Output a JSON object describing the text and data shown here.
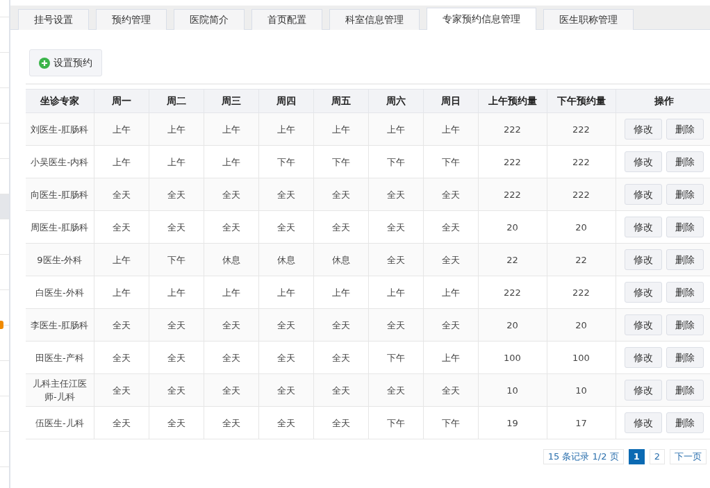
{
  "tabs": [
    {
      "label": "挂号设置",
      "selected": false
    },
    {
      "label": "预约管理",
      "selected": false
    },
    {
      "label": "医院简介",
      "selected": false
    },
    {
      "label": "首页配置",
      "selected": false
    },
    {
      "label": "科室信息管理",
      "selected": false
    },
    {
      "label": "专家预约信息管理",
      "selected": true
    },
    {
      "label": "医生职称管理",
      "selected": false
    }
  ],
  "toolbar": {
    "add_button": "设置预约"
  },
  "table": {
    "columns": [
      "坐诊专家",
      "周一",
      "周二",
      "周三",
      "周四",
      "周五",
      "周六",
      "周日",
      "上午预约量",
      "下午预约量",
      "操作"
    ],
    "rows": [
      {
        "expert": "刘医生-肛肠科",
        "days": [
          "上午",
          "上午",
          "上午",
          "上午",
          "上午",
          "上午",
          "上午"
        ],
        "am": "222",
        "pm": "222",
        "actions": [
          "修改",
          "删除"
        ]
      },
      {
        "expert": "小吴医生-内科",
        "days": [
          "上午",
          "上午",
          "上午",
          "下午",
          "下午",
          "下午",
          "下午"
        ],
        "am": "222",
        "pm": "222",
        "actions": [
          "修改",
          "删除"
        ]
      },
      {
        "expert": "向医生-肛肠科",
        "days": [
          "全天",
          "全天",
          "全天",
          "全天",
          "全天",
          "全天",
          "全天"
        ],
        "am": "222",
        "pm": "222",
        "actions": [
          "修改",
          "删除"
        ]
      },
      {
        "expert": "周医生-肛肠科",
        "days": [
          "全天",
          "全天",
          "全天",
          "全天",
          "全天",
          "全天",
          "全天"
        ],
        "am": "20",
        "pm": "20",
        "actions": [
          "修改",
          "删除"
        ]
      },
      {
        "expert": "9医生-外科",
        "days": [
          "上午",
          "下午",
          "休息",
          "休息",
          "休息",
          "全天",
          "全天"
        ],
        "am": "22",
        "pm": "22",
        "actions": [
          "修改",
          "删除"
        ]
      },
      {
        "expert": "白医生-外科",
        "days": [
          "上午",
          "上午",
          "上午",
          "上午",
          "上午",
          "上午",
          "上午"
        ],
        "am": "222",
        "pm": "222",
        "actions": [
          "修改",
          "删除"
        ]
      },
      {
        "expert": "李医生-肛肠科",
        "days": [
          "全天",
          "全天",
          "全天",
          "全天",
          "全天",
          "全天",
          "全天"
        ],
        "am": "20",
        "pm": "20",
        "actions": [
          "修改",
          "删除"
        ]
      },
      {
        "expert": "田医生-产科",
        "days": [
          "全天",
          "全天",
          "全天",
          "全天",
          "全天",
          "下午",
          "上午"
        ],
        "am": "100",
        "pm": "100",
        "actions": [
          "修改",
          "删除"
        ]
      },
      {
        "expert": "儿科主任江医师-儿科",
        "days": [
          "全天",
          "全天",
          "全天",
          "全天",
          "全天",
          "全天",
          "全天"
        ],
        "am": "10",
        "pm": "10",
        "actions": [
          "修改",
          "删除"
        ]
      },
      {
        "expert": "伍医生-儿科",
        "days": [
          "全天",
          "全天",
          "全天",
          "全天",
          "全天",
          "下午",
          "下午"
        ],
        "am": "19",
        "pm": "17",
        "actions": [
          "修改",
          "删除"
        ]
      }
    ]
  },
  "pagination": {
    "summary": "15 条记录 1/2 页",
    "pages": [
      {
        "label": "1",
        "selected": true
      },
      {
        "label": "2",
        "selected": false
      }
    ],
    "next": "下一页"
  }
}
